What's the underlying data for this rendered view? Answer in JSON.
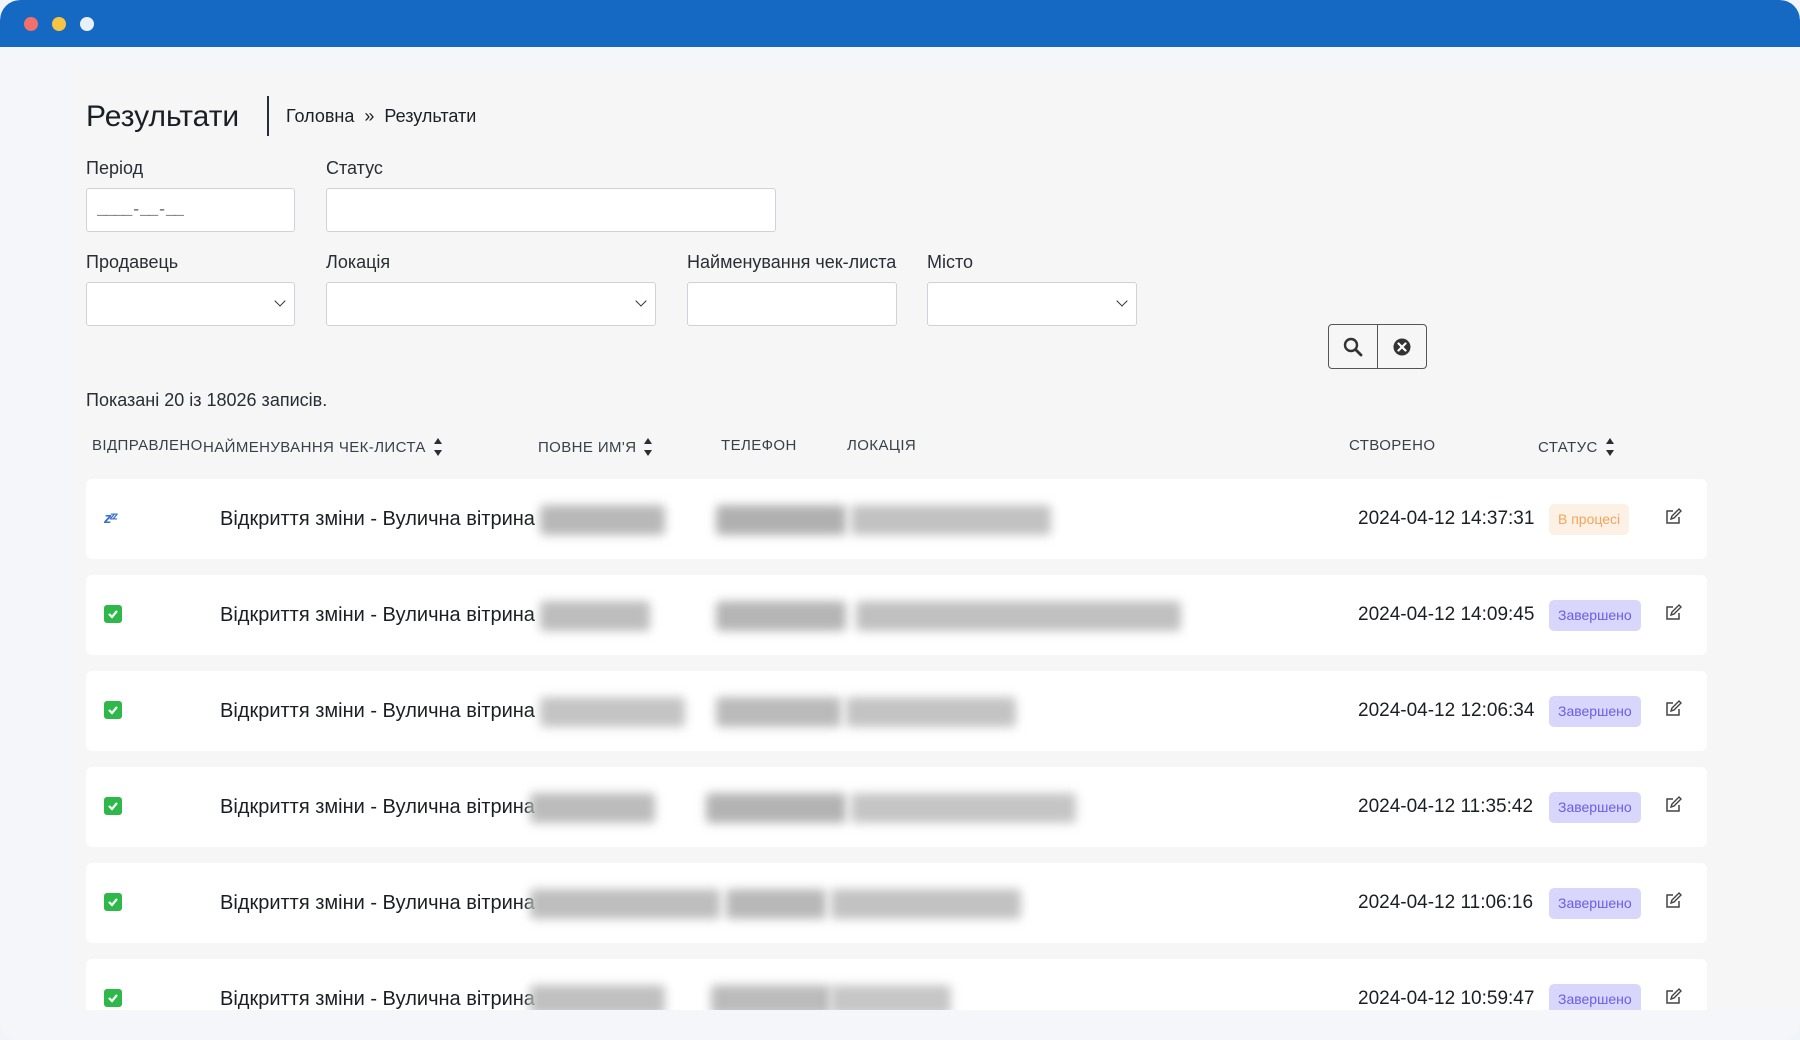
{
  "page": {
    "title": "Результати",
    "breadcrumb": {
      "home": "Головна",
      "separator": "»",
      "current": "Результати"
    }
  },
  "filters": {
    "period": {
      "label": "Період",
      "value": "____-__-__"
    },
    "status": {
      "label": "Статус",
      "value": ""
    },
    "seller": {
      "label": "Продавець",
      "value": ""
    },
    "location": {
      "label": "Локація",
      "value": ""
    },
    "checklist_name": {
      "label": "Найменування чек-листа",
      "value": ""
    },
    "city": {
      "label": "Місто",
      "value": ""
    },
    "search_icon": "search-icon",
    "clear_icon": "clear-circle-icon"
  },
  "records_info": "Показані 20 із 18026 записів.",
  "table": {
    "headers": {
      "sent": "ВІДПРАВЛЕНО",
      "checklist": "НАЙМЕНУВАННЯ ЧЕК-ЛИСТА",
      "full_name": "ПОВНЕ ИМ'Я",
      "phone": "ТЕЛЕФОН",
      "location": "ЛОКАЦІЯ",
      "created": "СТВОРЕНО",
      "status": "СТАТУС"
    },
    "rows": [
      {
        "sent_icon": "sleep-zzz-icon",
        "checklist": "Відкриття зміни - Вулична вітрина",
        "created": "2024-04-12 14:37:31",
        "status": "В процесі",
        "status_type": "progress"
      },
      {
        "sent_icon": "check-box-icon",
        "checklist": "Відкриття зміни - Вулична вітрина",
        "created": "2024-04-12 14:09:45",
        "status": "Завершено",
        "status_type": "done"
      },
      {
        "sent_icon": "check-box-icon",
        "checklist": "Відкриття зміни - Вулична вітрина",
        "created": "2024-04-12 12:06:34",
        "status": "Завершено",
        "status_type": "done"
      },
      {
        "sent_icon": "check-box-icon",
        "checklist": "Відкриття зміни - Вулична вітрина",
        "created": "2024-04-12 11:35:42",
        "status": "Завершено",
        "status_type": "done"
      },
      {
        "sent_icon": "check-box-icon",
        "checklist": "Відкриття зміни - Вулична вітрина",
        "created": "2024-04-12 11:06:16",
        "status": "Завершено",
        "status_type": "done"
      },
      {
        "sent_icon": "check-box-icon",
        "checklist": "Відкриття зміни - Вулична вітрина",
        "created": "2024-04-12 10:59:47",
        "status": "Завершено",
        "status_type": "done"
      }
    ]
  },
  "colors": {
    "titlebar": "#1669c3",
    "status_progress_bg": "#fdf0e4",
    "status_progress_text": "#f2a55b",
    "status_done_bg": "#d9d6fb",
    "status_done_text": "#6a5ee9",
    "check_green": "#2eb84a"
  }
}
